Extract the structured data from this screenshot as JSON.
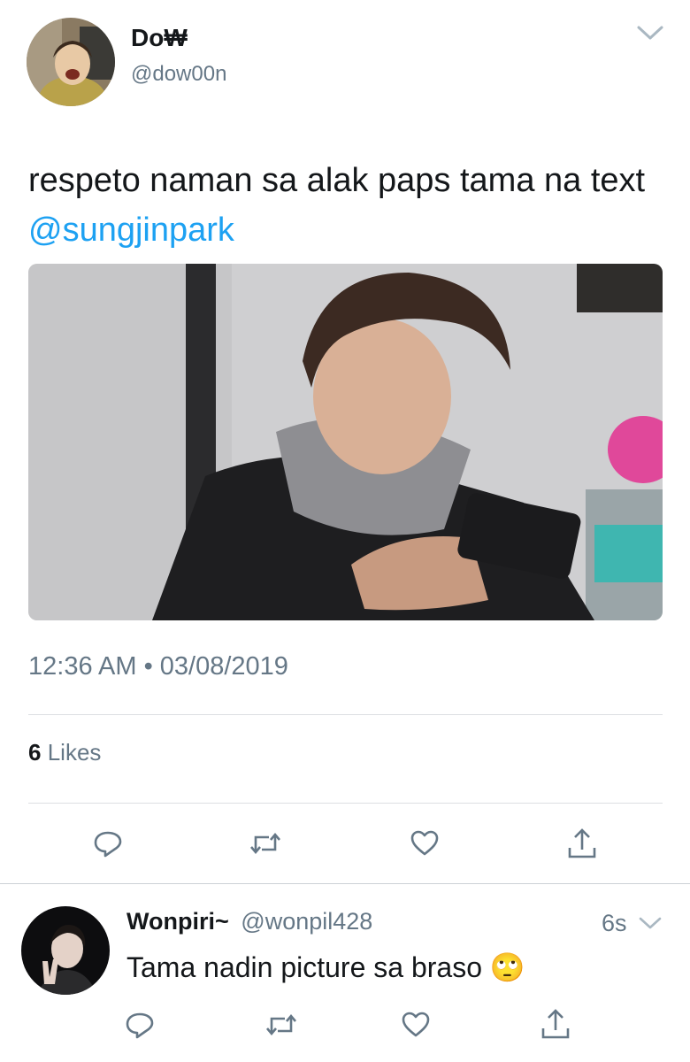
{
  "tweet": {
    "display_name": "Do₩",
    "handle": "@dow00n",
    "text_main": "respeto naman sa alak paps tama na text ",
    "mention": "@sungjinpark",
    "timestamp": "12:36 AM • 03/08/2019",
    "likes_count": "6",
    "likes_label": "Likes"
  },
  "actions": {
    "icons": [
      "reply-icon",
      "retweet-icon",
      "like-icon",
      "share-icon"
    ]
  },
  "reply": {
    "display_name": "Wonpiri~",
    "handle": "@wonpil428",
    "time": "6s",
    "text": "Tama nadin picture sa braso 🙄"
  },
  "colors": {
    "link": "#1da1f2",
    "muted": "#657786",
    "divider": "#dddfe2"
  }
}
